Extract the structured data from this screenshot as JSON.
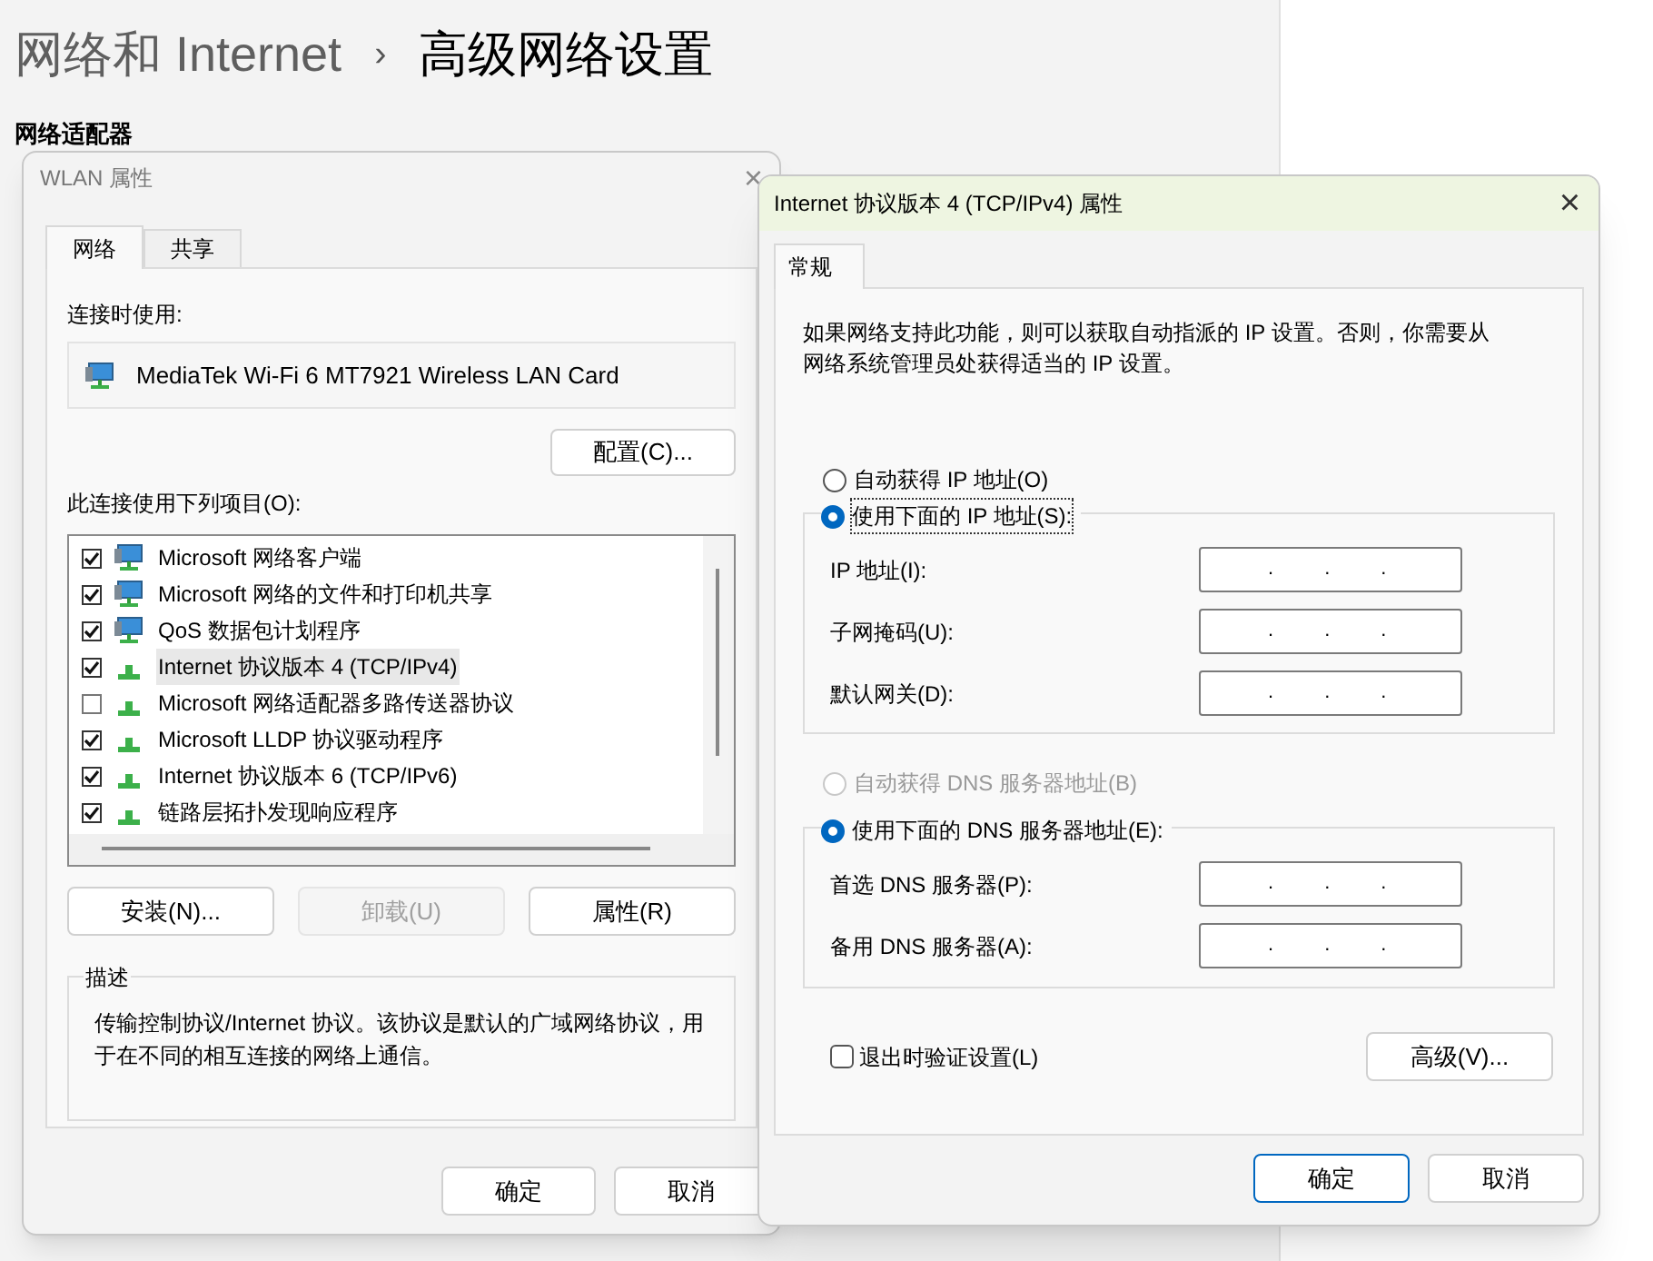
{
  "settings_page": {
    "breadcrumb_parent": "网络和 Internet",
    "breadcrumb_separator": "›",
    "title": "高级网络设置",
    "section": "网络适配器"
  },
  "wlan_dialog": {
    "title": "WLAN 属性",
    "close": "×",
    "tabs": [
      {
        "label": "网络",
        "selected": true
      },
      {
        "label": "共享",
        "selected": false
      }
    ],
    "connect_using_label": "连接时使用:",
    "adapter": "MediaTek Wi-Fi 6 MT7921 Wireless LAN Card",
    "configure_button": "配置(C)...",
    "items_label": "此连接使用下列项目(O):",
    "items": [
      {
        "kind": "service",
        "label": "Microsoft 网络客户端",
        "checked": true,
        "selected": false
      },
      {
        "kind": "service",
        "label": "Microsoft 网络的文件和打印机共享",
        "checked": true,
        "selected": false
      },
      {
        "kind": "service",
        "label": "QoS 数据包计划程序",
        "checked": true,
        "selected": false
      },
      {
        "kind": "protocol",
        "label": "Internet 协议版本 4 (TCP/IPv4)",
        "checked": true,
        "selected": true
      },
      {
        "kind": "protocol",
        "label": "Microsoft 网络适配器多路传送器协议",
        "checked": false,
        "selected": false
      },
      {
        "kind": "protocol",
        "label": "Microsoft LLDP 协议驱动程序",
        "checked": true,
        "selected": false
      },
      {
        "kind": "protocol",
        "label": "Internet 协议版本 6 (TCP/IPv6)",
        "checked": true,
        "selected": false
      },
      {
        "kind": "protocol",
        "label": "链路层拓扑发现响应程序",
        "checked": true,
        "selected": false
      }
    ],
    "action_buttons": [
      {
        "label": "安装(N)...",
        "disabled": false
      },
      {
        "label": "卸载(U)",
        "disabled": true
      },
      {
        "label": "属性(R)",
        "disabled": false
      }
    ],
    "description_legend": "描述",
    "description": "传输控制协议/Internet 协议。该协议是默认的广域网络协议，用于在不同的相互连接的网络上通信。",
    "buttons": [
      {
        "label": "确定",
        "default": false
      },
      {
        "label": "取消",
        "default": false
      }
    ]
  },
  "ipv4_dialog": {
    "title": "Internet 协议版本 4 (TCP/IPv4) 属性",
    "close": "×",
    "tabs": [
      {
        "label": "常规",
        "selected": true
      }
    ],
    "intro": "如果网络支持此功能，则可以获取自动指派的 IP 设置。否则，你需要从网络系统管理员处获得适当的 IP 设置。",
    "ip_radios": [
      {
        "label": "自动获得 IP 地址(O)",
        "selected": false,
        "disabled": false
      },
      {
        "label": "使用下面的 IP 地址(S):",
        "selected": true,
        "disabled": false,
        "focused": true
      }
    ],
    "ip_fields": [
      {
        "label": "IP 地址(I):",
        "separators": [
          ".",
          ".",
          "."
        ]
      },
      {
        "label": "子网掩码(U):",
        "separators": [
          ".",
          ".",
          "."
        ]
      },
      {
        "label": "默认网关(D):",
        "separators": [
          ".",
          ".",
          "."
        ]
      }
    ],
    "dns_radios": [
      {
        "label": "自动获得 DNS 服务器地址(B)",
        "selected": false,
        "disabled": true
      },
      {
        "label": "使用下面的 DNS 服务器地址(E):",
        "selected": true,
        "disabled": false
      }
    ],
    "dns_fields": [
      {
        "label": "首选 DNS 服务器(P):",
        "separators": [
          ".",
          ".",
          "."
        ]
      },
      {
        "label": "备用 DNS 服务器(A):",
        "separators": [
          ".",
          ".",
          "."
        ]
      }
    ],
    "validate_checkbox": {
      "label": "退出时验证设置(L)",
      "checked": false
    },
    "advanced_button": "高级(V)...",
    "buttons": [
      {
        "label": "确定",
        "default": true
      },
      {
        "label": "取消",
        "default": false
      }
    ]
  }
}
